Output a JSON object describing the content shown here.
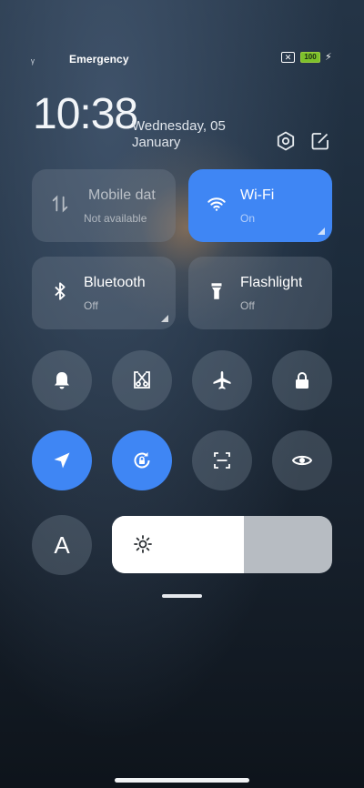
{
  "status_bar": {
    "signal_glyph": "ᵧ",
    "carrier": "Emergency",
    "sim_glyph": "✕",
    "battery": "100",
    "charging_glyph": "⚡"
  },
  "header": {
    "time": "10:38",
    "date_line1": "Wednesday, 05",
    "date_line2": "January"
  },
  "tiles": [
    {
      "title": "Mobile dat",
      "subtitle": "Not available",
      "state": "disabled"
    },
    {
      "title": "Wi-Fi",
      "subtitle": "On",
      "state": "on"
    },
    {
      "title": "Bluetooth",
      "subtitle": "Off",
      "state": "off"
    },
    {
      "title": "Flashlight",
      "subtitle": "Off",
      "state": "off"
    }
  ],
  "toggles_row1": [
    {
      "icon": "bell-icon",
      "state": "off"
    },
    {
      "icon": "screenshot-icon",
      "state": "off"
    },
    {
      "icon": "airplane-icon",
      "state": "off"
    },
    {
      "icon": "lock-icon",
      "state": "off"
    }
  ],
  "toggles_row2": [
    {
      "icon": "location-icon",
      "state": "on"
    },
    {
      "icon": "rotation-lock-icon",
      "state": "on"
    },
    {
      "icon": "scanner-icon",
      "state": "off"
    },
    {
      "icon": "eye-icon",
      "state": "off"
    }
  ],
  "auto_brightness": {
    "label": "A"
  },
  "brightness": {
    "level": 0.6,
    "icon": "sun-icon"
  },
  "colors": {
    "accent": "#3f86f4",
    "tile_bg": "rgba(120,135,150,0.32)",
    "battery_green": "#7cc12b"
  }
}
